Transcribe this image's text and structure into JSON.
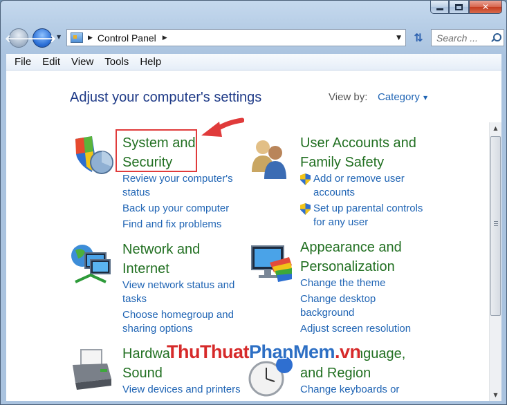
{
  "window": {
    "minimize_icon": "minimize-icon",
    "maximize_icon": "maximize-icon",
    "close_icon": "close-icon"
  },
  "nav": {
    "back_icon": "back-arrow-icon",
    "forward_icon": "forward-arrow-icon",
    "address_path": "Control Panel",
    "refresh_icon": "refresh-icon",
    "search_placeholder": "Search ..."
  },
  "menu": {
    "file": "File",
    "edit": "Edit",
    "view": "View",
    "tools": "Tools",
    "help": "Help"
  },
  "page": {
    "title": "Adjust your computer's settings",
    "view_by_label": "View by:",
    "view_by_value": "Category"
  },
  "categories": {
    "system": {
      "heading_line1": "System and",
      "heading_line2": "Security",
      "links": [
        "Review your computer's status",
        "Back up your computer",
        "Find and fix problems"
      ]
    },
    "users": {
      "heading_line1": "User Accounts and",
      "heading_line2": "Family Safety",
      "links": [
        "Add or remove user accounts",
        "Set up parental controls for any user"
      ]
    },
    "network": {
      "heading_line1": "Network and",
      "heading_line2": "Internet",
      "links": [
        "View network status and tasks",
        "Choose homegroup and sharing options"
      ]
    },
    "appearance": {
      "heading_line1": "Appearance and",
      "heading_line2": "Personalization",
      "links": [
        "Change the theme",
        "Change desktop background",
        "Adjust screen resolution"
      ]
    },
    "hardware": {
      "heading_line1": "Hardwa",
      "heading_line2": "Sound",
      "links": [
        "View devices and printers"
      ]
    },
    "clock": {
      "heading_line1": "nguage,",
      "heading_line2": "and Region",
      "links": [
        "Change keyboards or"
      ]
    }
  },
  "watermark": {
    "part1": "ThuThuat",
    "part2": "PhanMem",
    "part3": ".vn"
  },
  "accent": {
    "annotation_red": "#e03b3b",
    "heading_green": "#227022",
    "link_blue": "#1f64b4",
    "title_blue": "#1e3a87"
  }
}
